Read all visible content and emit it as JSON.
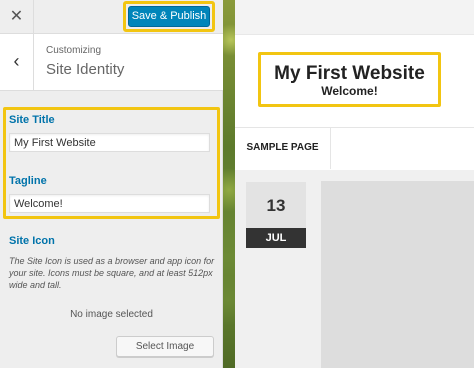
{
  "header": {
    "close_icon": "close-icon",
    "publish_label": "Save & Publish"
  },
  "section": {
    "back_icon": "chevron-left-icon",
    "breadcrumb": "Customizing",
    "title": "Site Identity"
  },
  "fields": {
    "site_title": {
      "label": "Site Title",
      "value": "My First Website"
    },
    "tagline": {
      "label": "Tagline",
      "value": "Welcome!"
    }
  },
  "site_icon": {
    "label": "Site Icon",
    "description": "The Site Icon is used as a browser and app icon for your site. Icons must be square, and at least 512px wide and tall.",
    "status": "No image selected",
    "select_label": "Select Image"
  },
  "preview": {
    "site_title": "My First Website",
    "tagline": "Welcome!",
    "nav": [
      "SAMPLE PAGE"
    ],
    "post_date": {
      "day": "13",
      "month": "JUL"
    }
  },
  "colors": {
    "highlight": "#f2c511",
    "primary_button": "#0085ba",
    "link_label": "#0073aa"
  }
}
